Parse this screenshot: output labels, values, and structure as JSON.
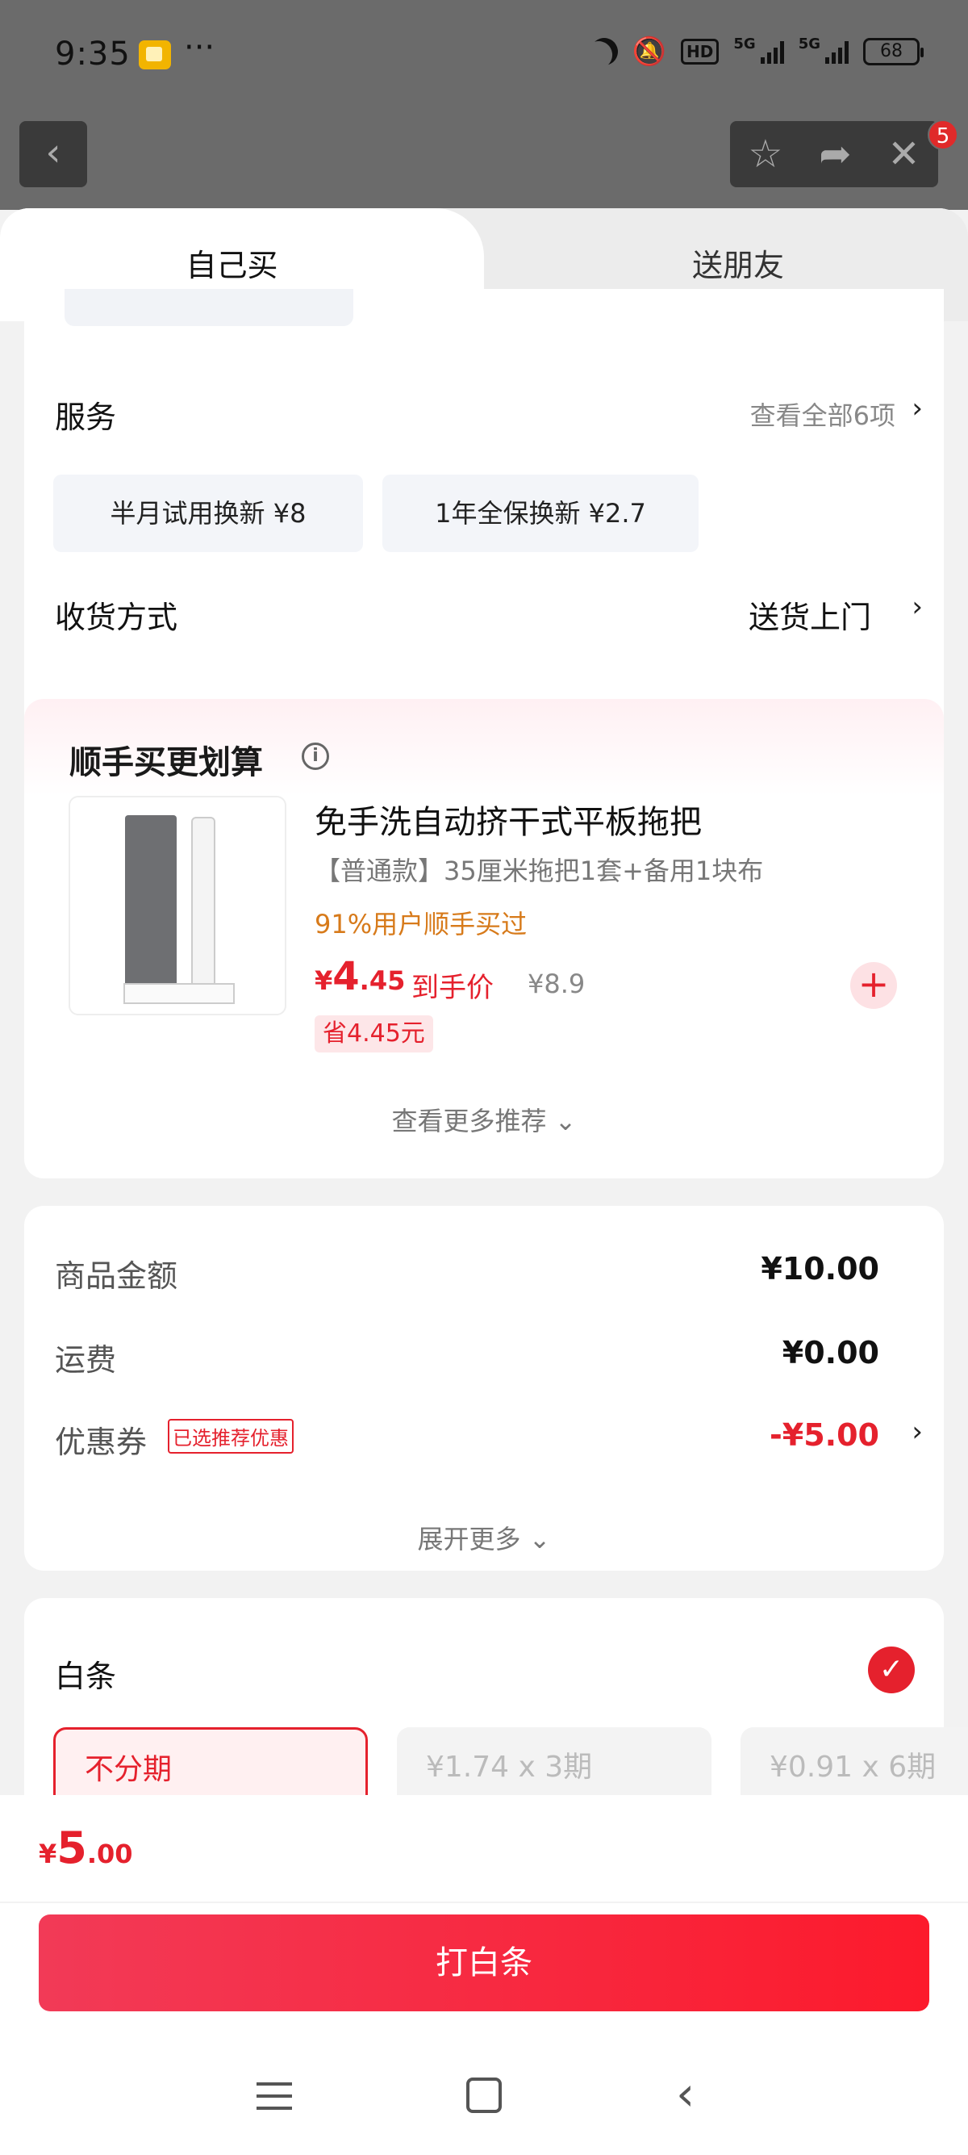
{
  "status_bar": {
    "time": "9:35",
    "dots": "···",
    "hd": "HD",
    "net1": "5G",
    "net2": "5G",
    "battery": "68"
  },
  "header": {
    "notification_count": "5"
  },
  "tabs": [
    {
      "label": "自己买"
    },
    {
      "label": "送朋友"
    }
  ],
  "services": {
    "title": "服务",
    "view_all": "查看全部6项",
    "options": [
      {
        "label": "半月试用换新  ¥8"
      },
      {
        "label": "1年全保换新  ¥2.7"
      }
    ]
  },
  "shipping": {
    "title": "收货方式",
    "value": "送货上门"
  },
  "recommend": {
    "title": "顺手买更划算",
    "product": {
      "name": "免手洗自动挤干式平板拖把",
      "spec": "【普通款】35厘米拖把1套+备用1块布",
      "bought": "91%用户顺手买过",
      "price_symbol": "¥",
      "price_int": "4",
      "price_dec": ".45",
      "price_label": "到手价",
      "original_price": "¥8.9",
      "save": "省4.45元"
    },
    "more": "查看更多推荐 ⌄"
  },
  "summary": {
    "items": [
      {
        "label": "商品金额",
        "value": "¥10.00"
      },
      {
        "label": "运费",
        "value": "¥0.00"
      },
      {
        "label": "优惠券",
        "value": "-¥5.00"
      }
    ],
    "coupon_tag": "已选推荐优惠",
    "expand": "展开更多 ⌄"
  },
  "baitiao": {
    "title": "白条",
    "plans": [
      {
        "label": "不分期"
      },
      {
        "label": "¥1.74 x 3期"
      },
      {
        "label": "¥0.91 x 6期"
      }
    ]
  },
  "footer": {
    "total_symbol": "¥",
    "total_int": "5",
    "total_dec": ".00",
    "pay_label": "打白条"
  },
  "colors": {
    "accent": "#e5212d",
    "price_orange": "#d77a1a",
    "background": "#f2f2f2"
  },
  "icons": [
    "back-icon",
    "star-icon",
    "share-icon",
    "close-icon",
    "info-icon",
    "plus-icon",
    "check-icon",
    "menu-icon",
    "home-icon",
    "nav-back-icon"
  ]
}
